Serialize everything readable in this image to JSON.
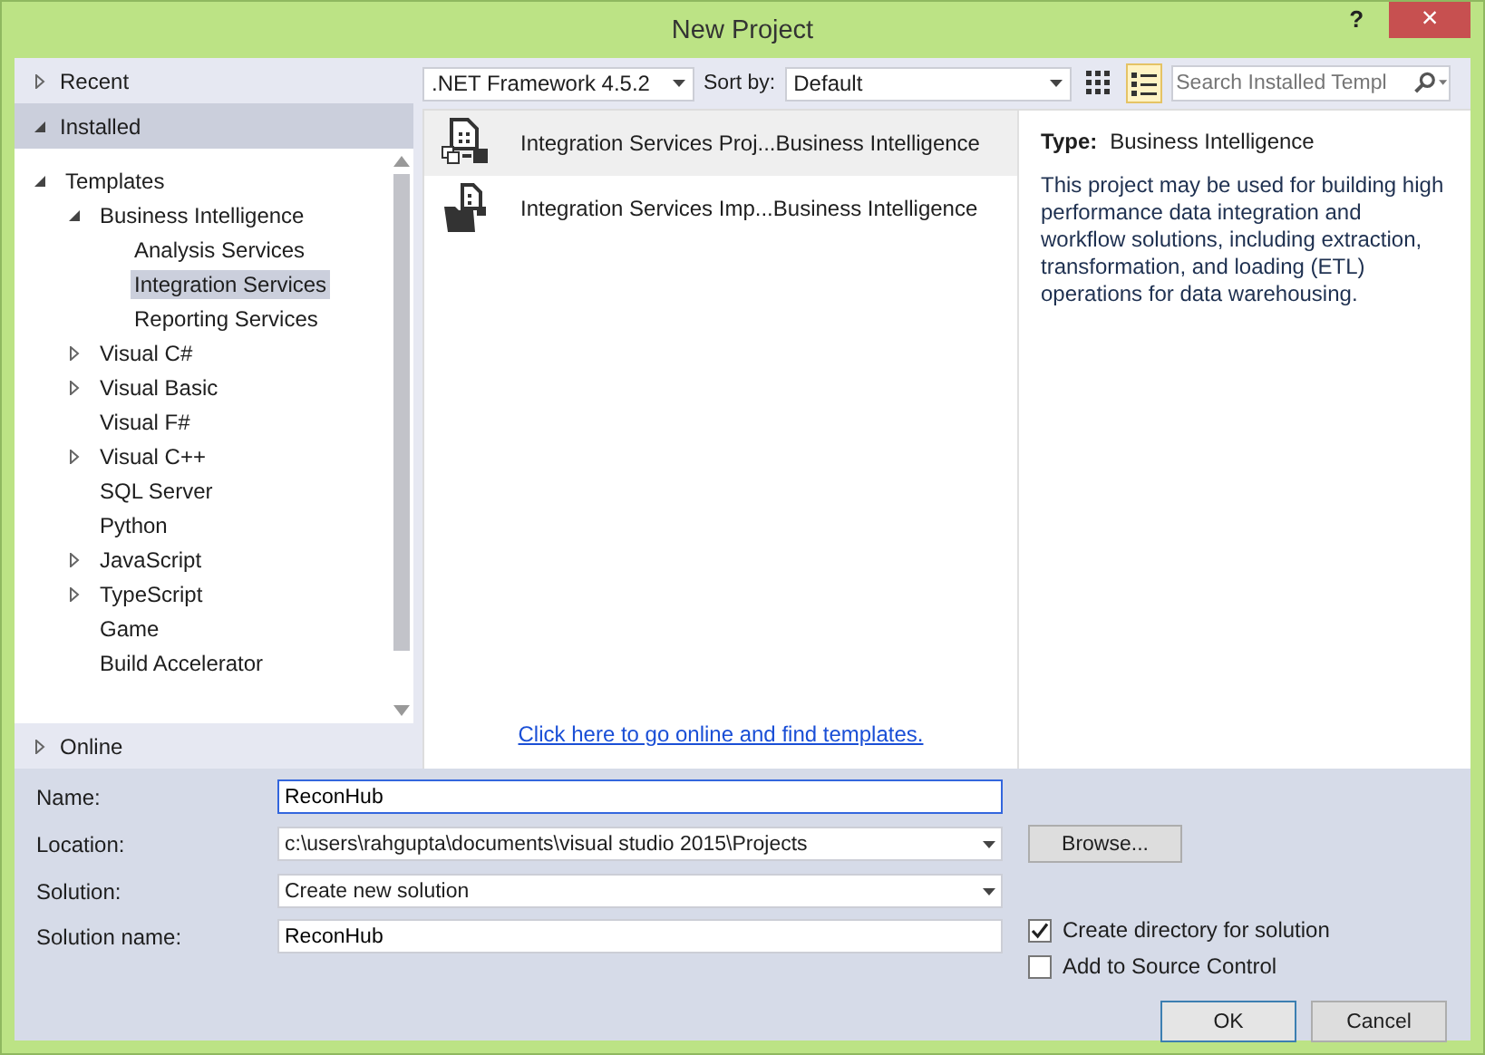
{
  "window": {
    "title": "New Project",
    "help": "?",
    "close": "×"
  },
  "sections": [
    {
      "label": "Recent",
      "expanded": false,
      "selected": false
    },
    {
      "label": "Installed",
      "expanded": true,
      "selected": true,
      "tree": [
        {
          "label": "Templates",
          "expanded": true,
          "selected": false,
          "children": [
            {
              "label": "Business Intelligence",
              "expanded": true,
              "selected": false,
              "children": [
                {
                  "label": "Analysis Services",
                  "selected": false
                },
                {
                  "label": "Integration Services",
                  "selected": true
                },
                {
                  "label": "Reporting Services",
                  "selected": false
                }
              ]
            },
            {
              "label": "Visual C#",
              "expanded": false,
              "selected": false
            },
            {
              "label": "Visual Basic",
              "expanded": false,
              "selected": false
            },
            {
              "label": "Visual F#",
              "selected": false
            },
            {
              "label": "Visual C++",
              "expanded": false,
              "selected": false
            },
            {
              "label": "SQL Server",
              "selected": false
            },
            {
              "label": "Python",
              "selected": false
            },
            {
              "label": "JavaScript",
              "expanded": false,
              "selected": false
            },
            {
              "label": "TypeScript",
              "expanded": false,
              "selected": false
            },
            {
              "label": "Game",
              "selected": false
            },
            {
              "label": "Build Accelerator",
              "selected": false
            }
          ]
        }
      ]
    },
    {
      "label": "Online",
      "expanded": false,
      "selected": false
    }
  ],
  "toolbar": {
    "framework": ".NET Framework 4.5.2",
    "sort_label": "Sort by:",
    "sort": "Default",
    "search_placeholder": "Search Installed Templ",
    "views": [
      {
        "kind": "grid",
        "selected": false
      },
      {
        "kind": "list",
        "selected": true
      }
    ]
  },
  "templates": [
    {
      "name": "Integration Services Proj...",
      "category": "Business Intelligence",
      "selected": true,
      "kind": "project"
    },
    {
      "name": "Integration Services Imp...",
      "category": "Business Intelligence",
      "selected": false,
      "kind": "import"
    }
  ],
  "online_link": "Click here to go online and find templates.",
  "details": {
    "type_label": "Type:",
    "type": "Business Intelligence",
    "description": "This project may be used for building high performance data integration and workflow solutions, including extraction, transformation, and loading (ETL) operations for data warehousing."
  },
  "form": {
    "name_label": "Name:",
    "name": "ReconHub",
    "location_label": "Location:",
    "location": "c:\\users\\rahgupta\\documents\\visual studio 2015\\Projects",
    "browse": "Browse...",
    "solution_label": "Solution:",
    "solution": "Create new solution",
    "solution_name_label": "Solution name:",
    "solution_name": "ReconHub"
  },
  "options": [
    {
      "label": "Create directory for solution",
      "checked": true
    },
    {
      "label": "Add to Source Control",
      "checked": false
    }
  ],
  "buttons": [
    {
      "label": "OK",
      "selected": true
    },
    {
      "label": "Cancel",
      "selected": false
    }
  ]
}
